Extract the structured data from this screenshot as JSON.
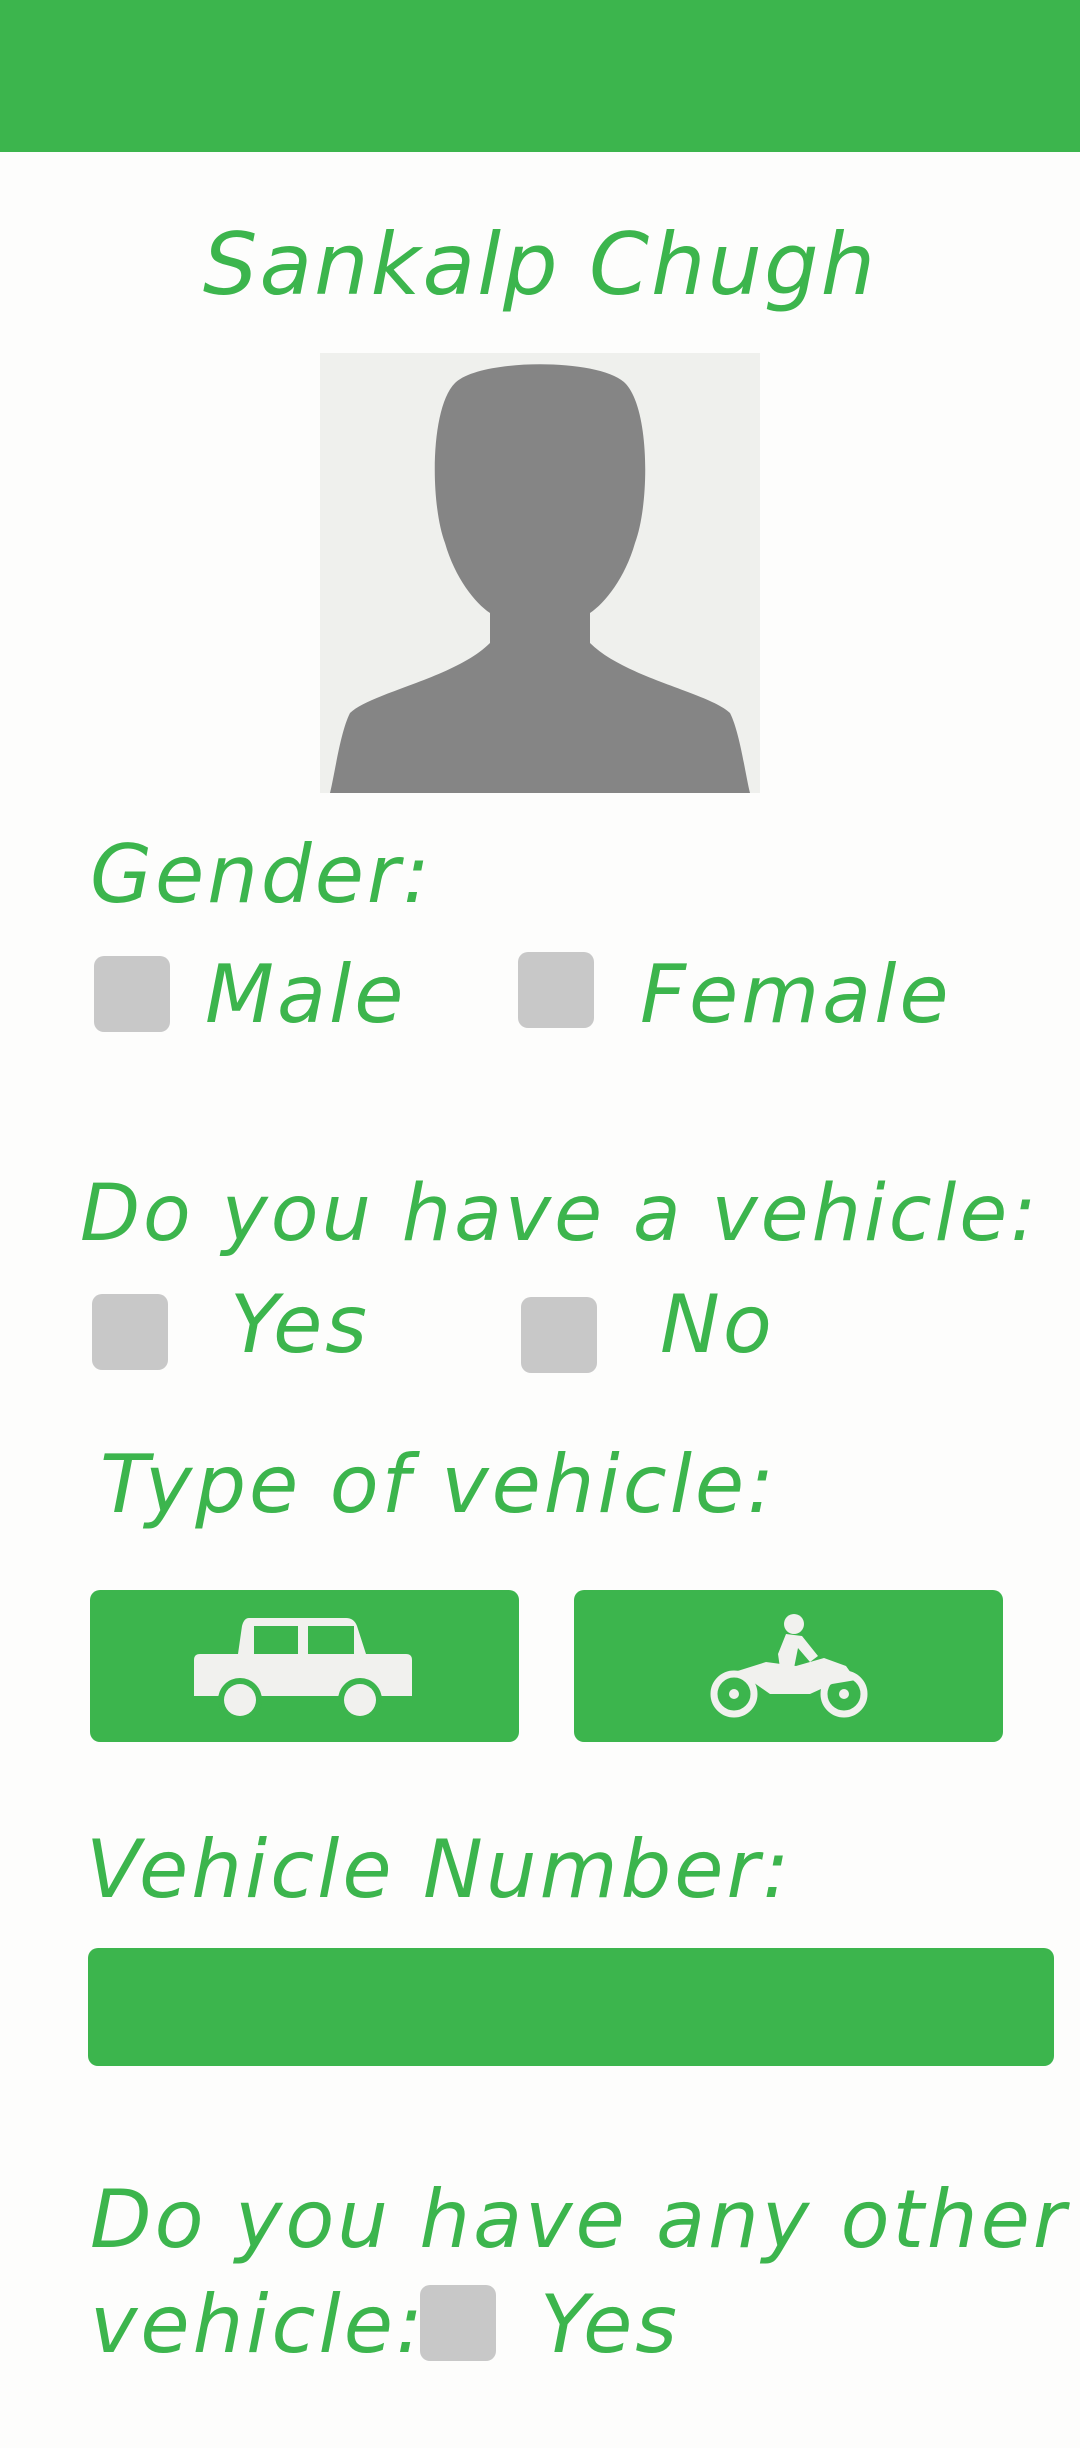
{
  "profile": {
    "name": "Sankalp Chugh"
  },
  "gender": {
    "label": "Gender:",
    "options": [
      "Male",
      "Female"
    ]
  },
  "vehicle_question": {
    "label": "Do you have a vehicle:",
    "options": [
      "Yes",
      "No"
    ]
  },
  "vehicle_type": {
    "label": "Type of vehicle:",
    "options": [
      "car-icon",
      "motorcycle-icon"
    ]
  },
  "vehicle_number": {
    "label": "Vehicle Number:",
    "value": ""
  },
  "other_vehicle": {
    "label_line1": "Do you have any other",
    "label_line2": "vehicle:",
    "option": "Yes"
  },
  "colors": {
    "accent": "#3cb54d",
    "checkbox": "#c8c8c8",
    "icon": "#f1f1ee"
  }
}
